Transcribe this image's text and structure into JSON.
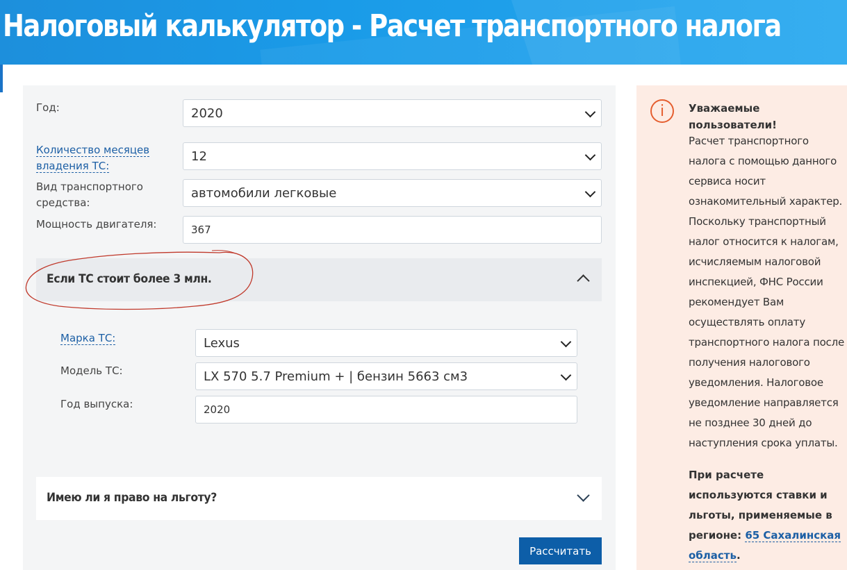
{
  "header": {
    "title": "Налоговый калькулятор - Расчет транспортного налога"
  },
  "form": {
    "year": {
      "label": "Год:",
      "value": "2020"
    },
    "months": {
      "label": "Количество месяцев владения ТС:",
      "value": "12"
    },
    "vehicle_type": {
      "label": "Вид транспортного средства:",
      "value": "автомобили легковые"
    },
    "engine_power": {
      "label": "Мощность двигателя:",
      "value": "367"
    }
  },
  "expensive_section": {
    "title": "Если ТС стоит более 3 млн.",
    "expanded": true,
    "brand": {
      "label": "Марка ТС:",
      "value": "Lexus"
    },
    "model": {
      "label": "Модель ТС:",
      "value": "LX 570 5.7 Premium + | бензин 5663 см3"
    },
    "year_of_manufacture": {
      "label": "Год выпуска:",
      "value": "2020"
    }
  },
  "benefit_section": {
    "title": "Имею ли я право на льготу?",
    "expanded": false
  },
  "calculate_button": {
    "label": "Рассчитать"
  },
  "notice": {
    "title": "Уважаемые пользователи!",
    "body": "Расчет транспортного налога с помощью данного сервиса носит ознакомительный характер. Поскольку транспортный налог относится к налогам, исчисляемым налоговой инспекцией, ФНС России рекомендует Вам осуществлять оплату транспортного налога после получения налогового уведомления. Налоговое уведомление направляется не позднее 30 дней до наступления срока уплаты.",
    "rates_prefix": "При расчете используются ставки и льготы, применяемые в регионе: ",
    "region_link": "65 Сахалинская область",
    "rates_suffix": "."
  },
  "colors": {
    "banner": "#1a9be8",
    "button": "#0d5ea8",
    "link": "#1c5fa5",
    "notice_bg": "#fdece4",
    "info_icon": "#e55e2f",
    "annotation": "#c0392b"
  },
  "icons": [
    "chevron-down-icon",
    "chevron-up-icon",
    "info-icon"
  ]
}
